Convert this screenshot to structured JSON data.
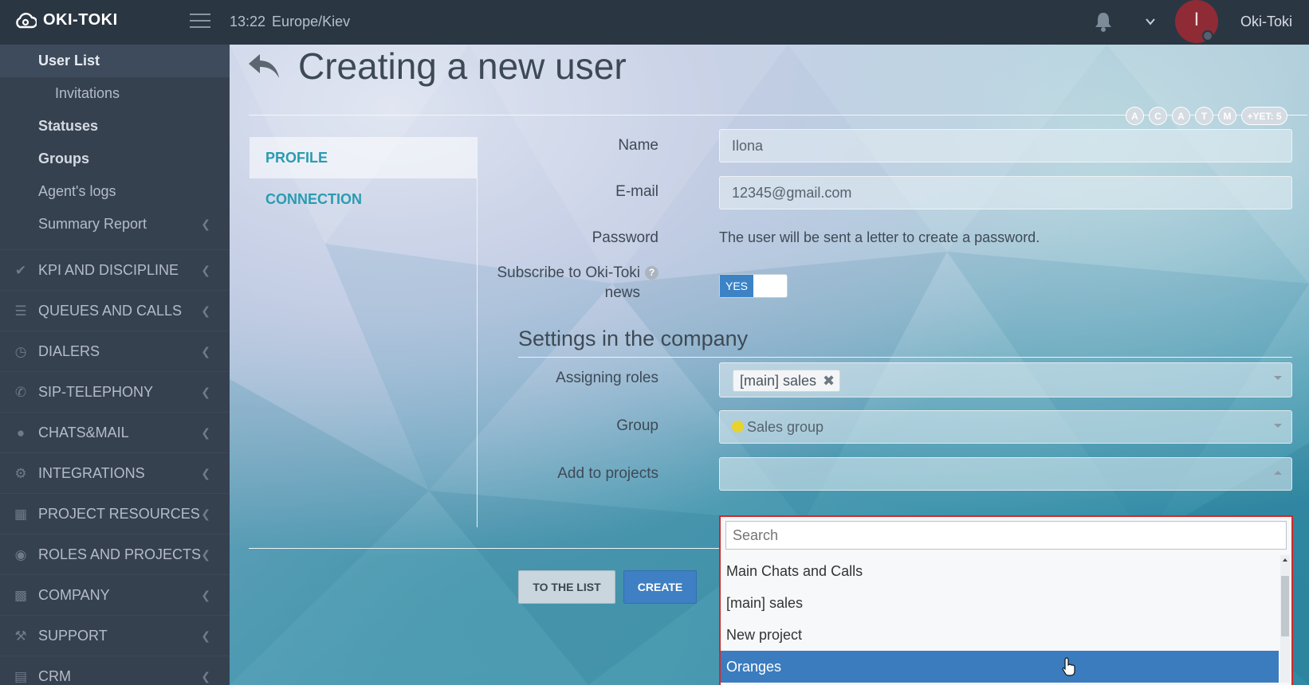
{
  "app": {
    "brand": "OKI-TOKI",
    "time": "13:22",
    "timezone": "Europe/Kiev",
    "username": "Oki-Toki",
    "avatar_letter": "I"
  },
  "sidebar": {
    "subitems": [
      {
        "label": "User List",
        "state": "active"
      },
      {
        "label": "Invitations"
      },
      {
        "label": "Statuses"
      },
      {
        "label": "Groups"
      },
      {
        "label": "Agent's logs"
      },
      {
        "label": "Summary Report"
      }
    ],
    "sections": [
      {
        "label": "KPI AND DISCIPLINE",
        "icon": "check-icon"
      },
      {
        "label": "QUEUES AND CALLS",
        "icon": "list-icon"
      },
      {
        "label": "DIALERS",
        "icon": "clock-icon"
      },
      {
        "label": "SIP-TELEPHONY",
        "icon": "phone-icon"
      },
      {
        "label": "CHATS&MAIL",
        "icon": "chat-icon"
      },
      {
        "label": "INTEGRATIONS",
        "icon": "gears-icon"
      },
      {
        "label": "PROJECT RESOURCES",
        "icon": "grid-icon"
      },
      {
        "label": "ROLES AND PROJECTS",
        "icon": "toggle-icon"
      },
      {
        "label": "COMPANY",
        "icon": "bar-chart-icon"
      },
      {
        "label": "SUPPORT",
        "icon": "wrench-icon"
      },
      {
        "label": "CRM",
        "icon": "card-icon"
      }
    ]
  },
  "page": {
    "title": "Creating a new user",
    "badges": [
      "A",
      "C",
      "A",
      "T",
      "M"
    ],
    "badge_more": "+YET: 5",
    "tabs": [
      "PROFILE",
      "CONNECTION"
    ]
  },
  "form": {
    "name_label": "Name",
    "name_value": "Ilona",
    "email_label": "E-mail",
    "email_value": "12345@gmail.com",
    "password_label": "Password",
    "password_note": "The user will be sent a letter to create a password.",
    "subscribe_label_1": "Subscribe to Oki-Toki",
    "subscribe_label_2": "news",
    "subscribe_help": "?",
    "subscribe_value": "YES",
    "section_title": "Settings in the company",
    "roles_label": "Assigning roles",
    "roles_chip": "[main] sales",
    "roles_chip_remove": "✖",
    "group_label": "Group",
    "group_value": "Sales group",
    "projects_label": "Add to projects",
    "to_list_button": "TO THE LIST",
    "create_button": "CREATE"
  },
  "dropdown": {
    "search_placeholder": "Search",
    "options": [
      "Main Chats and Calls",
      "[main] sales",
      "New project",
      "Oranges"
    ],
    "highlighted": "Oranges"
  },
  "colors": {
    "accent": "#2a9bb0",
    "primary": "#3f7fc3",
    "highlight": "#3b7cbf",
    "topbar": "#2b3643",
    "sidebar": "#364150",
    "error_border": "#cf2a2a"
  }
}
